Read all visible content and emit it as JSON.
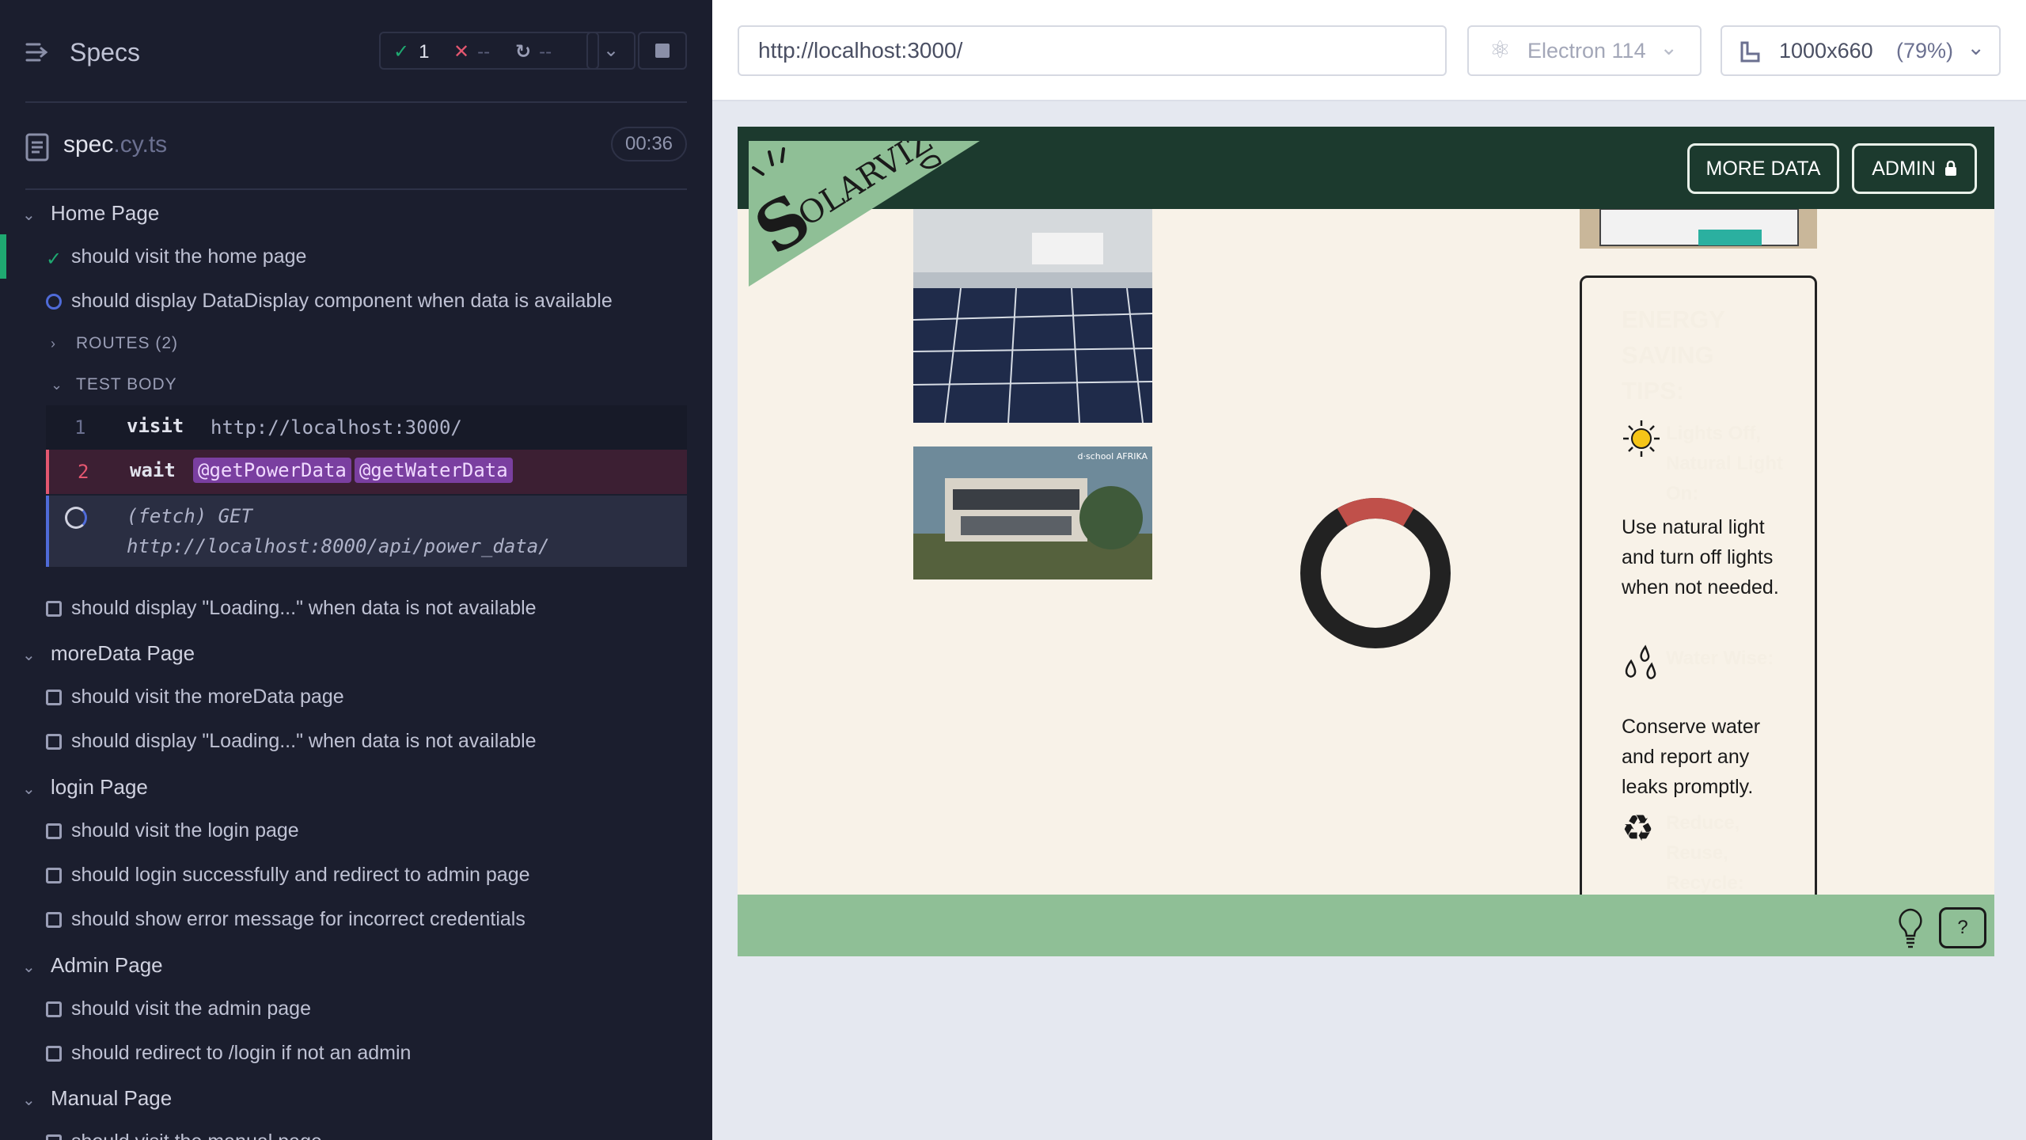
{
  "reporter": {
    "title": "Specs",
    "stats": {
      "passed": "1",
      "failed": "--",
      "pending": "--",
      "passed_icon": "✓",
      "failed_icon": "✕",
      "pending_icon": "↻"
    },
    "spec": {
      "name": "spec",
      "ext": ".cy.ts",
      "duration": "00:36"
    },
    "suites": {
      "home": "Home Page",
      "moredata": "moreData Page",
      "login": "login Page",
      "admin": "Admin Page",
      "manual": "Manual Page"
    },
    "tests": {
      "home_visit": "should visit the home page",
      "home_display": "should display DataDisplay component when data is available",
      "home_loading": "should display \"Loading...\" when data is not available",
      "more_visit": "should visit the moreData page",
      "more_loading": "should display \"Loading...\" when data is not available",
      "login_visit": "should visit the login page",
      "login_success": "should login successfully and redirect to admin page",
      "login_error": "should show error message for incorrect credentials",
      "admin_visit": "should visit the admin page",
      "admin_redirect": "should redirect to /login if not an admin",
      "manual_visit": "should visit the manual page"
    },
    "routes_label": "ROUTES (2)",
    "test_body_label": "TEST BODY",
    "commands": [
      {
        "num": "1",
        "name": "visit",
        "msg": "http://localhost:3000/"
      },
      {
        "num": "2",
        "name": "wait",
        "alias1": "@getPowerData",
        "alias2": "@getWaterData"
      }
    ],
    "fetch": {
      "line1": "(fetch)    GET",
      "line2": "http://localhost:8000/api/power_data/"
    }
  },
  "aut": {
    "url": "http://localhost:3000/",
    "browser": "Electron 114",
    "viewport": "1000x660",
    "scale": "(79%)",
    "app": {
      "logo_text": "SolarViz",
      "nav": {
        "more_data": "MORE DATA",
        "admin": "ADMIN"
      },
      "img2_caption": "d·school AFRIKA",
      "donut": {
        "red_fraction": 0.17,
        "red_color": "#c0504a",
        "dark_color": "#222222"
      },
      "tips": {
        "title": "ENERGY SAVING TIPS:",
        "items": [
          {
            "icon": "sun-icon",
            "head": "Lights Off, Natural Light On:",
            "body": "Use natural light and turn off lights when not needed."
          },
          {
            "icon": "water-drops-icon",
            "head": "Water Wise:",
            "body": "Conserve water and report any leaks promptly."
          },
          {
            "icon": "recycle-icon",
            "head": "Reduce, Reuse, Recycle:",
            "body": ""
          }
        ]
      },
      "footer": {
        "help": "?"
      }
    }
  }
}
